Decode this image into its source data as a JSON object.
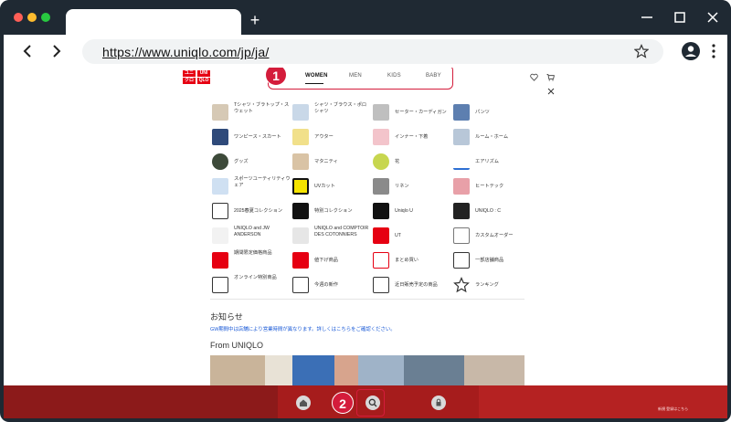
{
  "browser": {
    "url": "https://www.uniqlo.com/jp/ja/",
    "new_tab": "+"
  },
  "page": {
    "logo": [
      "ユニ",
      "UNI",
      "クロ",
      "QLO"
    ],
    "categories": [
      "WOMEN",
      "MEN",
      "KIDS",
      "BABY"
    ],
    "badges": [
      "1",
      "2"
    ],
    "items": [
      [
        "Tシャツ・ブラトップ・スウェット",
        "シャツ・ブラウス・ポロシャツ",
        "セーター・カーディガン",
        "パンツ"
      ],
      [
        "ワンピース・スカート",
        "アウター",
        "インナー・下着",
        "ルーム・ホーム"
      ],
      [
        "グッズ",
        "マタニティ",
        "花",
        "エアリズム"
      ],
      [
        "スポーツユーティリティウェア",
        "UVカット",
        "リネン",
        "ヒートテック"
      ],
      [
        "2025春夏コレクション",
        "特別コレクション",
        "Uniqlo U",
        "UNIQLO : C"
      ],
      [
        "UNIQLO and JW ANDERSON",
        "UNIQLO and COMPTOIR DES COTONNIERS",
        "UT",
        "カスタムオーダー"
      ],
      [
        "期間限定価格商品",
        "値下げ商品",
        "まとめ買い",
        "一部店舗商品"
      ],
      [
        "オンライン特別商品",
        "今週の新作",
        "近日販売予定の商品",
        "ランキング"
      ]
    ],
    "news_heading": "お知らせ",
    "news_link": "GW期間中は店舗により営業時間が異なります。詳しくはこちらをご確認ください。",
    "from_heading": "From UNIQLO",
    "bottom_text": "新規 登録はこちら"
  },
  "colors": {
    "accent": "#d41c3b",
    "brand_red": "#e60012",
    "frame": "#1f2933",
    "link": "#1a5ad7"
  }
}
